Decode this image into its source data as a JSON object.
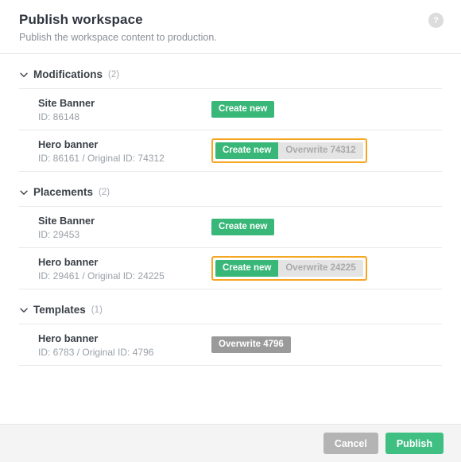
{
  "header": {
    "title": "Publish workspace",
    "subtitle": "Publish the workspace content to production.",
    "help_icon_label": "?"
  },
  "sections": [
    {
      "title": "Modifications",
      "count": "(2)",
      "rows": [
        {
          "name": "Site Banner",
          "id_text": "ID: 86148",
          "control": "single",
          "primary_label": "Create new"
        },
        {
          "name": "Hero banner",
          "id_text": "ID: 86161 / Original ID: 74312",
          "control": "segmented-focused",
          "primary_label": "Create new",
          "secondary_label": "Overwrite 74312"
        }
      ]
    },
    {
      "title": "Placements",
      "count": "(2)",
      "rows": [
        {
          "name": "Site Banner",
          "id_text": "ID: 29453",
          "control": "single",
          "primary_label": "Create new"
        },
        {
          "name": "Hero banner",
          "id_text": "ID: 29461 / Original ID: 24225",
          "control": "segmented-focused",
          "primary_label": "Create new",
          "secondary_label": "Overwrite 24225"
        }
      ]
    },
    {
      "title": "Templates",
      "count": "(1)",
      "rows": [
        {
          "name": "Hero banner",
          "id_text": "ID: 6783 / Original ID: 4796",
          "control": "overwrite-only",
          "primary_label": "Overwrite 4796"
        }
      ]
    }
  ],
  "footer": {
    "cancel_label": "Cancel",
    "publish_label": "Publish"
  },
  "colors": {
    "green": "#39b778",
    "publish_green": "#40bf83",
    "focus_orange": "#f5a623",
    "gray_solid": "#9a9a9a",
    "gray_inactive_bg": "#e4e4e4",
    "gray_inactive_text": "#a9a9a9",
    "cancel_gray": "#b4b4b4",
    "footer_bg": "#f4f4f4"
  }
}
